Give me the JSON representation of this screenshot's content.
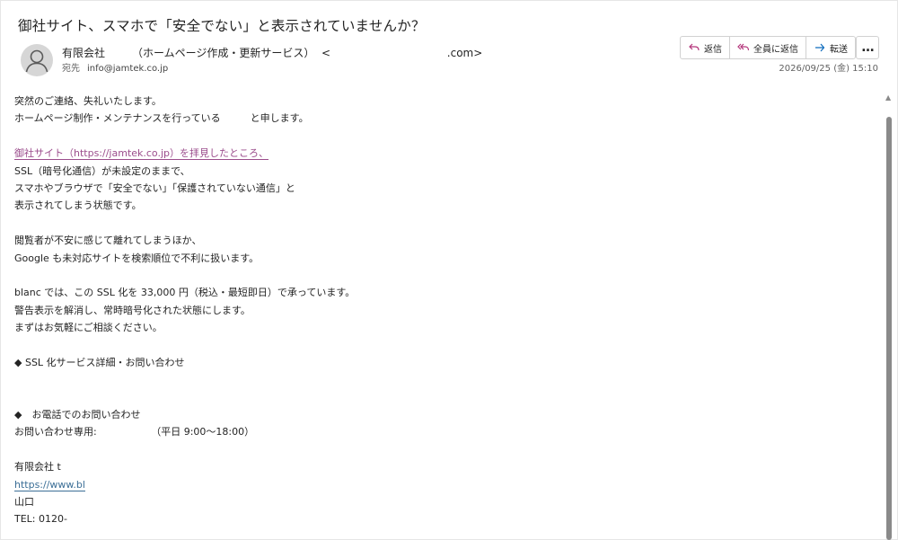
{
  "email": {
    "subject": "御社サイト、スマホで「安全でない」と表示されていませんか？",
    "sender": "有限会社　　　（ホームページ作成・更新サービス）  <                                  .com>",
    "to_label": "宛先",
    "to_value": "info@jamtek.co.jp",
    "date": "2026/09/25 (金) 15:10"
  },
  "actions": {
    "reply": "返信",
    "reply_all": "全員に返信",
    "forward": "転送",
    "more": "…"
  },
  "body": {
    "l1": "突然のご連絡、失礼いたします。",
    "l2": "ホームページ制作・メンテナンスを行っている　　　と申します。",
    "l3": "御社サイト（https://jamtek.co.jp）を拝見したところ、",
    "l4": "SSL（暗号化通信）が未設定のままで、",
    "l5": "スマホやブラウザで「安全でない」「保護されていない通信」と",
    "l6": "表示されてしまう状態です。",
    "l7": "閲覧者が不安に感じて離れてしまうほか、",
    "l8": "Google も未対応サイトを検索順位で不利に扱います。",
    "l9": "blanc では、この SSL 化を 33,000 円（税込・最短即日）で承っています。",
    "l10": "警告表示を解消し、常時暗号化された状態にします。",
    "l11": "まずはお気軽にご相談ください。",
    "l12": "◆ SSL 化サービス詳細・お問い合わせ",
    "l13": "◆　お電話でのお問い合わせ",
    "l14": "お問い合わせ専用:　　　　　　（平日 9:00〜18:00）",
    "l15": "有限会社 t",
    "l16": "https://www.bl",
    "l17": "山口",
    "l18": "TEL: 0120-"
  },
  "icons": {
    "avatar": "person-icon",
    "reply": "reply-arrow-icon",
    "reply_all": "reply-all-arrow-icon",
    "forward": "forward-arrow-icon"
  },
  "colors": {
    "accent": "#0f6cbd",
    "link_visited": "#9b4d8c",
    "link": "#3b6e96"
  }
}
